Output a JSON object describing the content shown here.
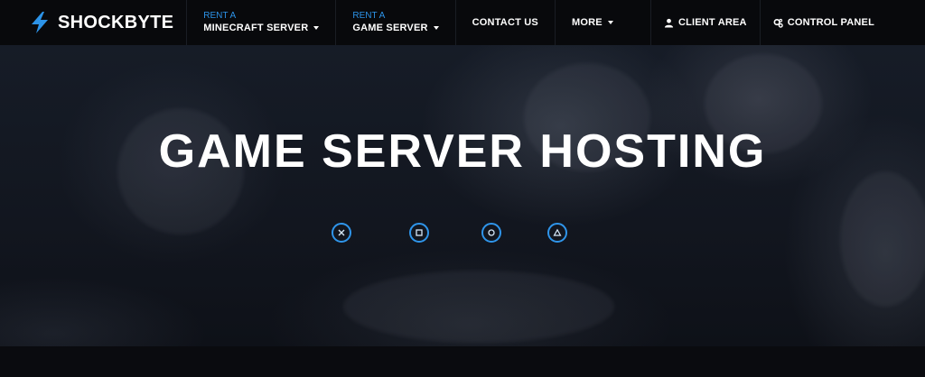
{
  "brand": {
    "name": "SHOCKBYTE",
    "accent": "#2c93e8"
  },
  "nav": {
    "minecraft": {
      "kicker": "RENT A",
      "label": "MINECRAFT SERVER"
    },
    "game": {
      "kicker": "RENT A",
      "label": "GAME SERVER"
    },
    "contact": {
      "label": "CONTACT US"
    },
    "more": {
      "label": "MORE"
    },
    "client_area": {
      "label": "CLIENT AREA",
      "icon": "user-icon"
    },
    "control_panel": {
      "label": "CONTROL PANEL",
      "icon": "gears-icon"
    }
  },
  "hero": {
    "title": "GAME SERVER HOSTING",
    "buttons": [
      {
        "icon": "cross-icon"
      },
      {
        "icon": "square-icon"
      },
      {
        "icon": "circle-icon"
      },
      {
        "icon": "triangle-icon"
      }
    ]
  }
}
